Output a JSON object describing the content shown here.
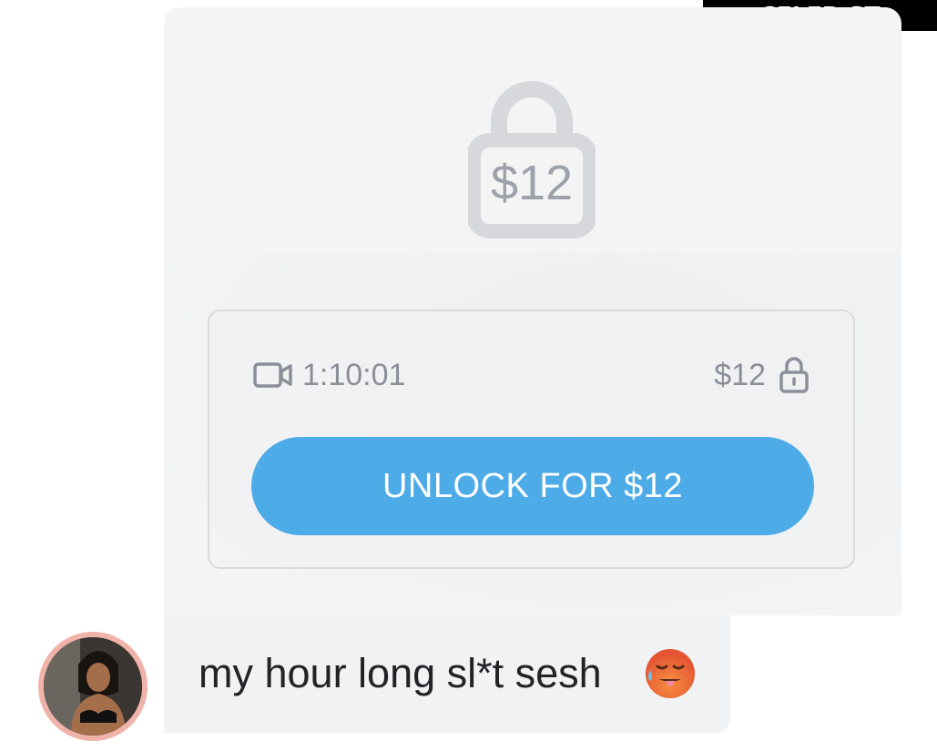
{
  "watermark": {
    "text": "CELEB.ST"
  },
  "media": {
    "lock_price": "$12",
    "duration": "1:10:01",
    "price": "$12",
    "unlock_button_label": "UNLOCK FOR $12",
    "icons": [
      "lock-icon",
      "video-camera-icon",
      "padlock-icon"
    ]
  },
  "message": {
    "text": "my hour long sl*t sesh",
    "emoji": "hot-face-emoji"
  },
  "colors": {
    "accent": "#4dabe8",
    "card_bg": "#f4f4f5",
    "muted": "#8a8f99",
    "avatar_ring": "#f0b3a9"
  }
}
